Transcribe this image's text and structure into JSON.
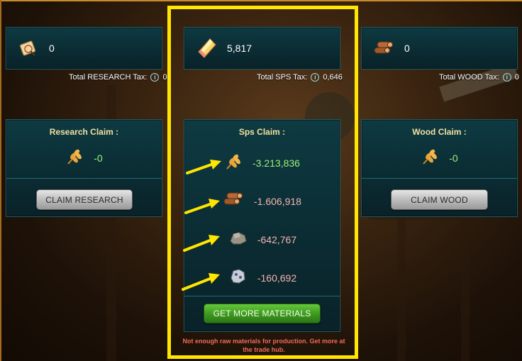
{
  "research": {
    "balance": "0",
    "tax_label": "Total RESEARCH Tax:",
    "tax_value": "0",
    "claim_title": "Research Claim :",
    "claim_amount": "-0",
    "button_label": "CLAIM RESEARCH",
    "icon": "research-scroll-icon"
  },
  "sps": {
    "balance": "5,817",
    "tax_label": "Total SPS Tax:",
    "tax_value": "0,646",
    "claim_title": "Sps Claim :",
    "materials": [
      {
        "icon": "grain-icon",
        "amount": "-3.213,836"
      },
      {
        "icon": "wood-icon",
        "amount": "-1.606,918"
      },
      {
        "icon": "stone-icon",
        "amount": "-642,767"
      },
      {
        "icon": "iron-icon",
        "amount": "-160,692"
      }
    ],
    "button_label": "GET MORE MATERIALS",
    "warning": "Not enough raw materials for production. Get more at the trade hub.",
    "icon": "sps-crystal-icon"
  },
  "wood": {
    "balance": "0",
    "tax_label": "Total WOOD Tax:",
    "tax_value": "0",
    "claim_title": "Wood Claim :",
    "claim_amount": "-0",
    "button_label": "CLAIM WOOD",
    "icon": "wood-logs-icon"
  },
  "colors": {
    "highlight": "#ffe500",
    "positive": "#9ef07a",
    "negative": "#f5b3b0",
    "warning": "#f06a5a",
    "panel": "#0b2c33"
  },
  "info_icon": "info-icon"
}
